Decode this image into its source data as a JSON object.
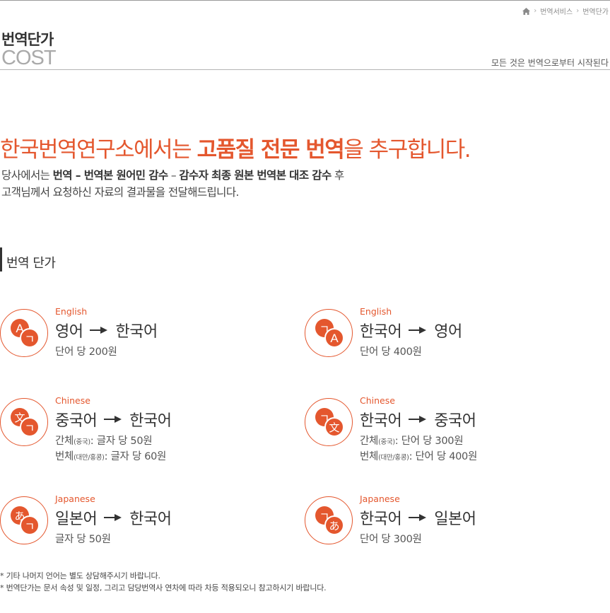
{
  "breadcrumb": {
    "home_icon": "home-icon",
    "level1": "번역서비스",
    "level2": "번역단가"
  },
  "header": {
    "title": "번역단가",
    "subtitle": "COST",
    "slogan": "모든 것은 번역으로부터 시작된다"
  },
  "intro": {
    "headline_pre": "한국번역연구소에서는 ",
    "headline_bold": "고품질 전문 번역",
    "headline_post": "을 추구합니다.",
    "line1_pre": "당사에서는 ",
    "line1_bold1": "번역 – 번역본 원어민 감수",
    "line1_mid": " – ",
    "line1_bold2": "감수자 최종 원본 번역본 대조 감수",
    "line1_post": " 후",
    "line2": "고객님께서 요청하신 자료의 결과물을 전달해드립니다."
  },
  "section": {
    "title": "번역 단가"
  },
  "colors": {
    "accent": "#e4572e",
    "text": "#333333",
    "muted": "#aaaaaa"
  },
  "items": [
    {
      "icon": "english-to-korean-icon",
      "lang": "English",
      "from": "영어",
      "to": "한국어",
      "price1": "단어 당 200원"
    },
    {
      "icon": "korean-to-english-icon",
      "lang": "English",
      "from": "한국어",
      "to": "영어",
      "price1": "단어 당 400원"
    },
    {
      "icon": "chinese-to-korean-icon",
      "lang": "Chinese",
      "from": "중국어",
      "to": "한국어",
      "p1_label": "간체",
      "p1_note": "(중국)",
      "p1_value": ": 글자 당 50원",
      "p2_label": "번체",
      "p2_note": "(대만/홍콩)",
      "p2_value": ": 글자 당 60원"
    },
    {
      "icon": "korean-to-chinese-icon",
      "lang": "Chinese",
      "from": "한국어",
      "to": "중국어",
      "p1_label": "간체",
      "p1_note": "(중국)",
      "p1_value": ": 단어 당 300원",
      "p2_label": "번체",
      "p2_note": "(대만/홍콩)",
      "p2_value": ": 단어 당 400원"
    },
    {
      "icon": "japanese-to-korean-icon",
      "lang": "Japanese",
      "from": "일본어",
      "to": "한국어",
      "price1": "글자 당 50원"
    },
    {
      "icon": "korean-to-japanese-icon",
      "lang": "Japanese",
      "from": "한국어",
      "to": "일본어",
      "price1": "단어 당 300원"
    }
  ],
  "icon_glyphs": {
    "latin": "A",
    "korean": "ㄱ",
    "chinese": "文",
    "japanese": "あ"
  },
  "notes": [
    "* 기타 나머지 언어는 별도 상담해주시기 바랍니다.",
    "* 번역단가는 문서 속성 및 일정, 그리고 담당번역사 연차에 따라 차등 적용되오니 참고하시기 바랍니다."
  ]
}
